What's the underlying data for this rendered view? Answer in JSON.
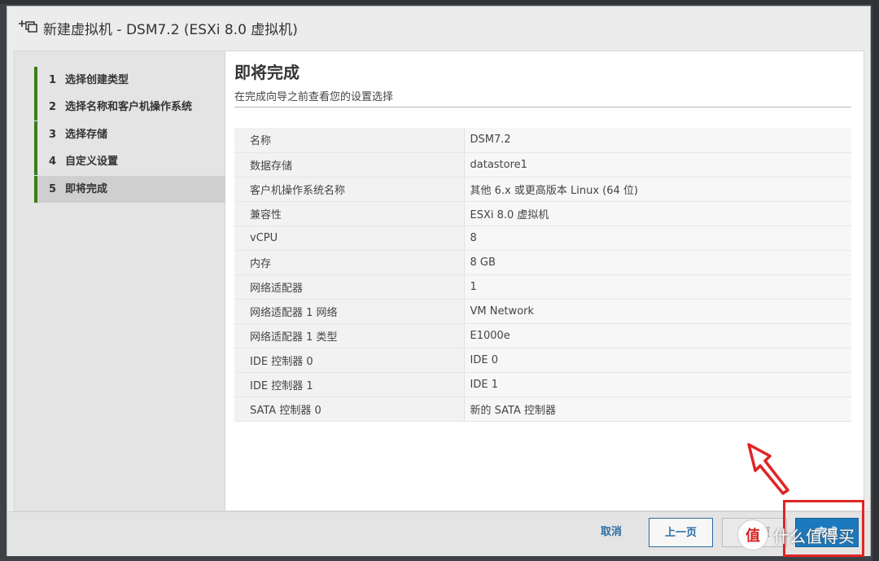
{
  "dialog": {
    "title": "新建虚拟机 - DSM7.2 (ESXi 8.0 虚拟机)",
    "icon": "add-vm-icon"
  },
  "steps": [
    {
      "num": "1",
      "label": "选择创建类型"
    },
    {
      "num": "2",
      "label": "选择名称和客户机操作系统"
    },
    {
      "num": "3",
      "label": "选择存储"
    },
    {
      "num": "4",
      "label": "自定义设置"
    },
    {
      "num": "5",
      "label": "即将完成"
    }
  ],
  "active_step": 5,
  "main": {
    "heading": "即将完成",
    "subheading": "在完成向导之前查看您的设置选择",
    "summary": [
      {
        "key": "名称",
        "value": "DSM7.2"
      },
      {
        "key": "数据存储",
        "value": "datastore1"
      },
      {
        "key": "客户机操作系统名称",
        "value": "其他 6.x 或更高版本 Linux (64 位)"
      },
      {
        "key": "兼容性",
        "value": "ESXi 8.0 虚拟机"
      },
      {
        "key": "vCPU",
        "value": "8"
      },
      {
        "key": "内存",
        "value": "8 GB"
      },
      {
        "key": "网络适配器",
        "value": "1"
      },
      {
        "key": "网络适配器 1 网络",
        "value": "VM Network"
      },
      {
        "key": "网络适配器 1 类型",
        "value": "E1000e"
      },
      {
        "key": "IDE 控制器 0",
        "value": "IDE 0"
      },
      {
        "key": "IDE 控制器 1",
        "value": "IDE 1"
      },
      {
        "key": "SATA 控制器 0",
        "value": "新的 SATA 控制器"
      }
    ]
  },
  "footer": {
    "cancel": "取消",
    "prev": "上一页",
    "next": "下一页",
    "finish": "完成"
  },
  "watermark": {
    "logo": "值",
    "text": "什么值得买"
  },
  "colors": {
    "accent": "#1c79be",
    "step_marker": "#3c7c1b",
    "annotation": "#e02424"
  }
}
